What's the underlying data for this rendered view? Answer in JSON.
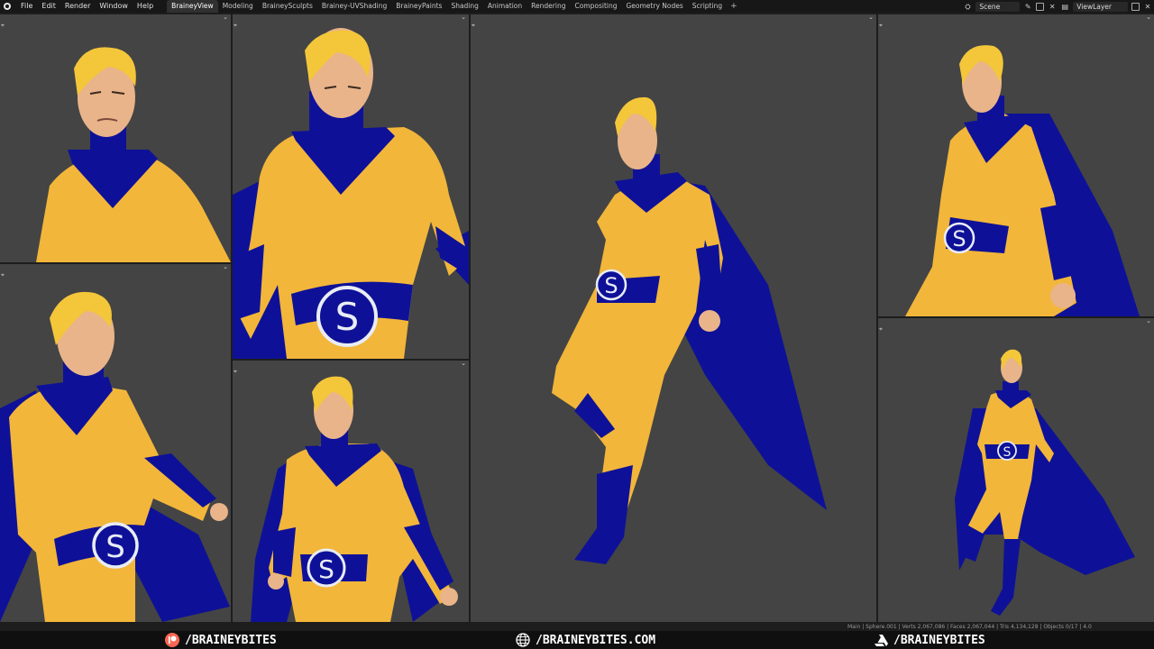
{
  "app": {
    "menus": [
      "File",
      "Edit",
      "Render",
      "Window",
      "Help"
    ],
    "workspaces": [
      "BraineyView",
      "Modeling",
      "BraineySculpts",
      "Brainey-UVShading",
      "BraineyPaints",
      "Shading",
      "Animation",
      "Rendering",
      "Compositing",
      "Geometry Nodes",
      "Scripting"
    ],
    "active_workspace": "BraineyView",
    "add_workspace": "+",
    "scene": "Scene",
    "view_layer": "ViewLayer"
  },
  "viewports": {
    "corner_glyph": "⌖",
    "collapse_glyph": "⌄",
    "bg_color": "#444444",
    "suit_yellow": "#f2b63a",
    "suit_blue": "#0e1197",
    "emblem": "S"
  },
  "statusbar": {
    "text": "Main | Sphere.001 | Verts 2,067,086 | Faces 2,067,044 | Tris 4,134,128 | Objects 0/17 | 4.0"
  },
  "footer": {
    "patreon": "/BRAINEYBITES",
    "website": "/BRAINEYBITES.COM",
    "artstation": "/BRAINEYBITES"
  }
}
